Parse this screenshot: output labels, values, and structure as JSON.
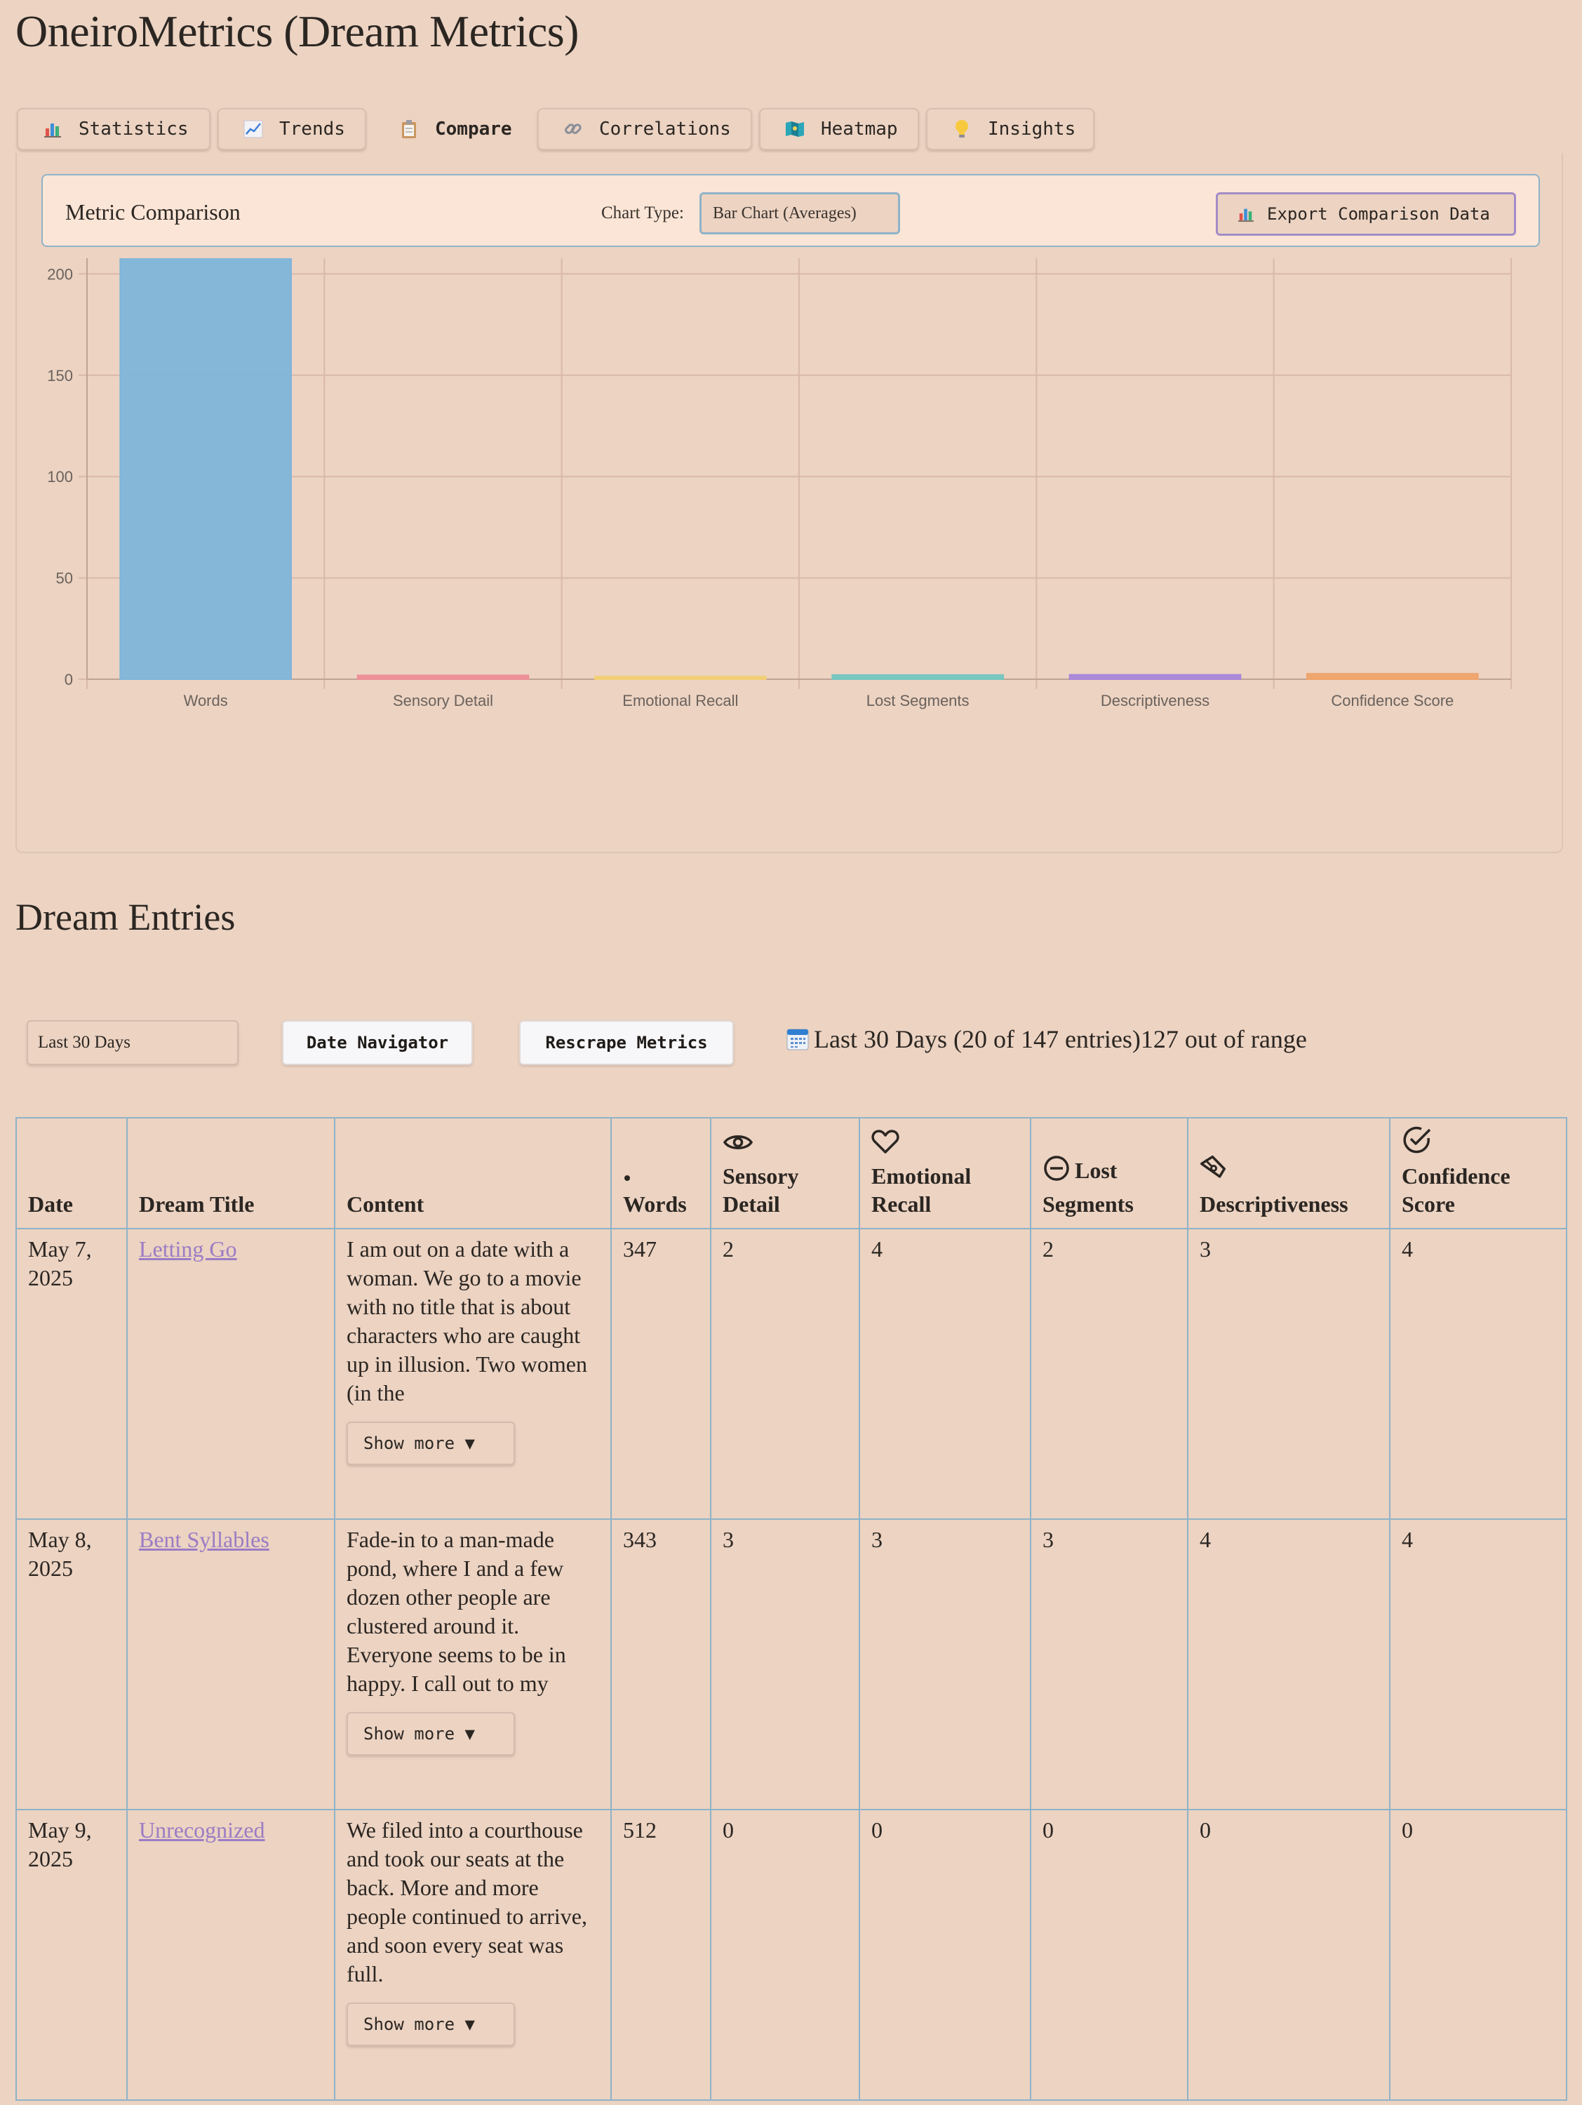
{
  "app": {
    "title": "OneiroMetrics (Dream Metrics)"
  },
  "tabs": [
    {
      "label": "Statistics",
      "icon": "bar-chart-icon",
      "active": false
    },
    {
      "label": "Trends",
      "icon": "trend-chart-icon",
      "active": false
    },
    {
      "label": "Compare",
      "icon": "clipboard-icon",
      "active": true
    },
    {
      "label": "Correlations",
      "icon": "link-icon",
      "active": false
    },
    {
      "label": "Heatmap",
      "icon": "map-icon",
      "active": false
    },
    {
      "label": "Insights",
      "icon": "lightbulb-icon",
      "active": false
    }
  ],
  "compare": {
    "title": "Metric Comparison",
    "chart_type_label": "Chart Type:",
    "chart_type_value": "Bar Chart (Averages)",
    "export_label": "Export Comparison Data"
  },
  "chart_data": {
    "type": "bar",
    "categories": [
      "Words",
      "Sensory Detail",
      "Emotional Recall",
      "Lost Segments",
      "Descriptiveness",
      "Confidence Score"
    ],
    "values": [
      234.5,
      1.9,
      1.3,
      2.1,
      2.2,
      2.7
    ],
    "colors": [
      "#7fb5da",
      "#ec8e96",
      "#f2cf73",
      "#73c6bf",
      "#a986d8",
      "#efa46a"
    ],
    "ylim": [
      0,
      250
    ],
    "yticks": [
      0,
      50,
      100,
      150,
      200,
      250
    ],
    "grid": true,
    "legend": "none"
  },
  "entries": {
    "title": "Dream Entries",
    "range_value": "Last 30 Days",
    "date_navigator_label": "Date Navigator",
    "rescrape_label": "Rescrape Metrics",
    "range_status": "Last 30 Days (20 of 147 entries)127 out of range",
    "columns": [
      {
        "label": "Date",
        "icon": ""
      },
      {
        "label": "Dream Title",
        "icon": ""
      },
      {
        "label": "Content",
        "icon": ""
      },
      {
        "label": "Words",
        "icon": "dot-icon"
      },
      {
        "label": "Sensory Detail",
        "icon": "eye-icon"
      },
      {
        "label": "Emotional Recall",
        "icon": "heart-icon"
      },
      {
        "label": "Lost Segments",
        "icon": "minus-circle-icon"
      },
      {
        "label": "Descriptiveness",
        "icon": "pen-tool-icon"
      },
      {
        "label": "Confidence Score",
        "icon": "check-circle-icon"
      }
    ],
    "show_more_label": "Show more ▼",
    "rows": [
      {
        "date": "May 7, 2025",
        "title": "Letting Go",
        "content": "I am out on a date with a woman. We go to a movie with no title that is about characters who are caught up in illusion. Two women (in the",
        "words": "347",
        "sensory": "2",
        "emotional": "4",
        "lost": "2",
        "descriptiveness": "3",
        "confidence": "4"
      },
      {
        "date": "May 8, 2025",
        "title": "Bent Syllables",
        "content": "Fade-in to a man-made pond, where I and a few dozen other people are clustered around it. Everyone seems to be in happy. I call out to my",
        "words": "343",
        "sensory": "3",
        "emotional": "3",
        "lost": "3",
        "descriptiveness": "4",
        "confidence": "4"
      },
      {
        "date": "May 9, 2025",
        "title": "Unrecognized",
        "content": "We filed into a courthouse and took our seats at the back. More and more people continued to arrive, and soon every seat was full.",
        "words": "512",
        "sensory": "0",
        "emotional": "0",
        "lost": "0",
        "descriptiveness": "0",
        "confidence": "0"
      }
    ]
  }
}
